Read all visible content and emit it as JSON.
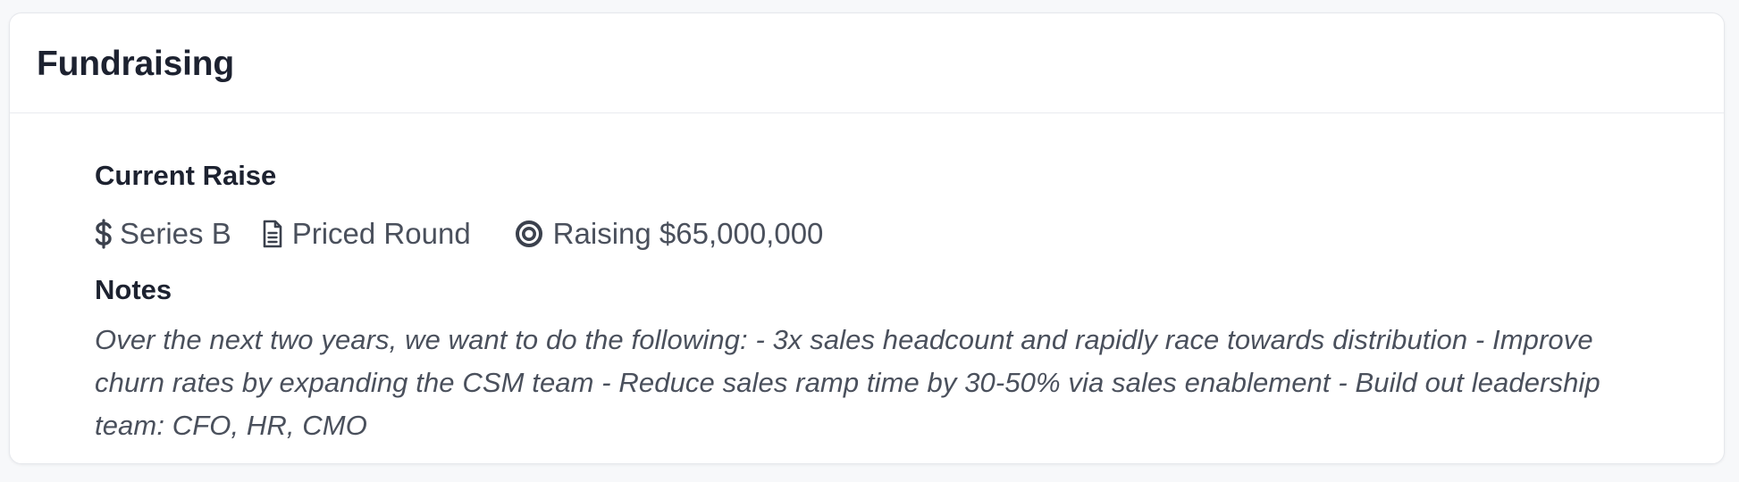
{
  "card": {
    "title": "Fundraising"
  },
  "current_raise": {
    "heading": "Current Raise",
    "series": "Series B",
    "round_type": "Priced Round",
    "target": "Raising $65,000,000"
  },
  "notes": {
    "heading": "Notes",
    "text": "Over the next two years, we want to do the following: - 3x sales headcount and rapidly race towards distribution - Improve churn rates by expanding the CSM team - Reduce sales ramp time by 30-50% via sales enablement - Build out leadership team: CFO, HR, CMO"
  },
  "icons": {
    "series": "dollar-icon",
    "round_type": "document-icon",
    "target": "target-icon"
  },
  "colors": {
    "page_background": "#f7f8fa",
    "card_background": "#ffffff",
    "heading_text": "#1d2230",
    "body_text": "#4a505c",
    "divider": "#e9ebef"
  }
}
